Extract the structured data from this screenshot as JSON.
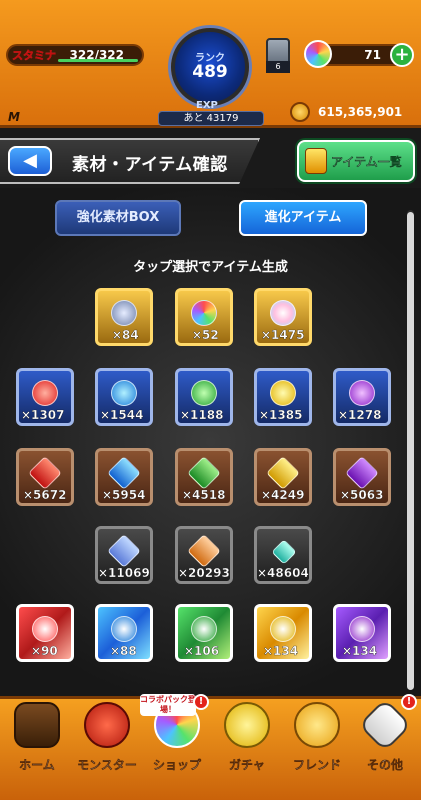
{
  "header": {
    "stamina_label": "スタミナ",
    "stamina_value": "322/322",
    "rank_label": "ランク",
    "rank_value": "489",
    "exp_label": "EXP",
    "exp_remaining": "あと 43179",
    "lantern_count": "6",
    "orb_count": "71",
    "coin_value": "615,365,901",
    "m_mark": "M"
  },
  "title_bar": {
    "back_label": "◀",
    "title": "素材・アイテム確認",
    "item_list_button": "アイテム一覧"
  },
  "tabs": {
    "enhance": "強化素材BOX",
    "evolve": "進化アイテム"
  },
  "hint": "タップ選択でアイテム生成",
  "items": {
    "row1": [
      {
        "name": "special-emblem",
        "count": "×84"
      },
      {
        "name": "rainbow-hook",
        "count": "×52"
      },
      {
        "name": "rainbow-sphere",
        "count": "×1475"
      }
    ],
    "row2": [
      {
        "name": "fire-orb",
        "count": "×1307"
      },
      {
        "name": "water-orb",
        "count": "×1544"
      },
      {
        "name": "wood-orb",
        "count": "×1188"
      },
      {
        "name": "light-orb",
        "count": "×1385"
      },
      {
        "name": "dark-orb",
        "count": "×1278"
      }
    ],
    "row3": [
      {
        "name": "fire-stone",
        "count": "×5672"
      },
      {
        "name": "water-stone",
        "count": "×5954"
      },
      {
        "name": "wood-stone",
        "count": "×4518"
      },
      {
        "name": "light-stone",
        "count": "×4249"
      },
      {
        "name": "dark-stone",
        "count": "×5063"
      }
    ],
    "row4": [
      {
        "name": "blue-crystal",
        "count": "×11069"
      },
      {
        "name": "orange-crystal",
        "count": "×20293"
      },
      {
        "name": "teal-crystal",
        "count": "×48604"
      }
    ],
    "row5": [
      {
        "name": "fire-rainbow-beast",
        "count": "×90"
      },
      {
        "name": "water-rainbow-beast",
        "count": "×88"
      },
      {
        "name": "wood-rainbow-beast",
        "count": "×106"
      },
      {
        "name": "light-rainbow-beast",
        "count": "×134"
      },
      {
        "name": "dark-rainbow-beast",
        "count": "×134"
      }
    ]
  },
  "collab_badge": "コラボパック登場！",
  "bottom_nav": [
    {
      "label": "ホーム"
    },
    {
      "label": "モンスター"
    },
    {
      "label": "ショップ"
    },
    {
      "label": "ガチャ"
    },
    {
      "label": "フレンド"
    },
    {
      "label": "その他"
    }
  ],
  "colors": {
    "header_orange": "#f59a1e",
    "tab_active_blue": "#2ea6ff",
    "item_list_green": "#1f9e4b"
  }
}
